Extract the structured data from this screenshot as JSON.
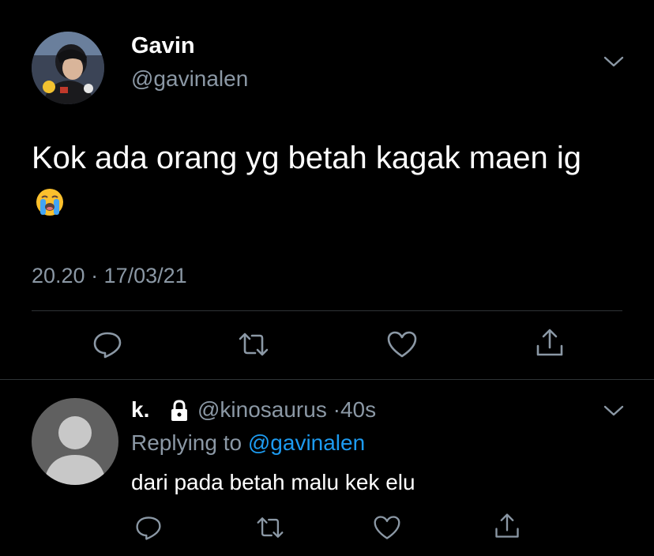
{
  "tweet": {
    "display_name": "Gavin",
    "handle": "@gavinalen",
    "text": "Kok ada orang yg betah kagak maen ig",
    "emoji": "loudly-crying-face",
    "timestamp": "20.20 · 17/03/21",
    "actions": [
      "reply-icon",
      "retweet-icon",
      "like-icon",
      "share-icon"
    ]
  },
  "reply": {
    "display_name": "k.",
    "protected_icon": "lock-icon",
    "handle": "@kinosaurus",
    "separator": "·",
    "time_ago": "40s",
    "replying_prefix": "Replying to",
    "replying_to": "@gavinalen",
    "text": "dari pada betah malu kek elu",
    "actions": [
      "reply-icon",
      "retweet-icon",
      "like-icon",
      "share-icon"
    ]
  },
  "colors": {
    "background": "#000000",
    "secondary_text": "#8b98a5",
    "mention": "#1d9bf0",
    "divider": "#2f3336"
  }
}
